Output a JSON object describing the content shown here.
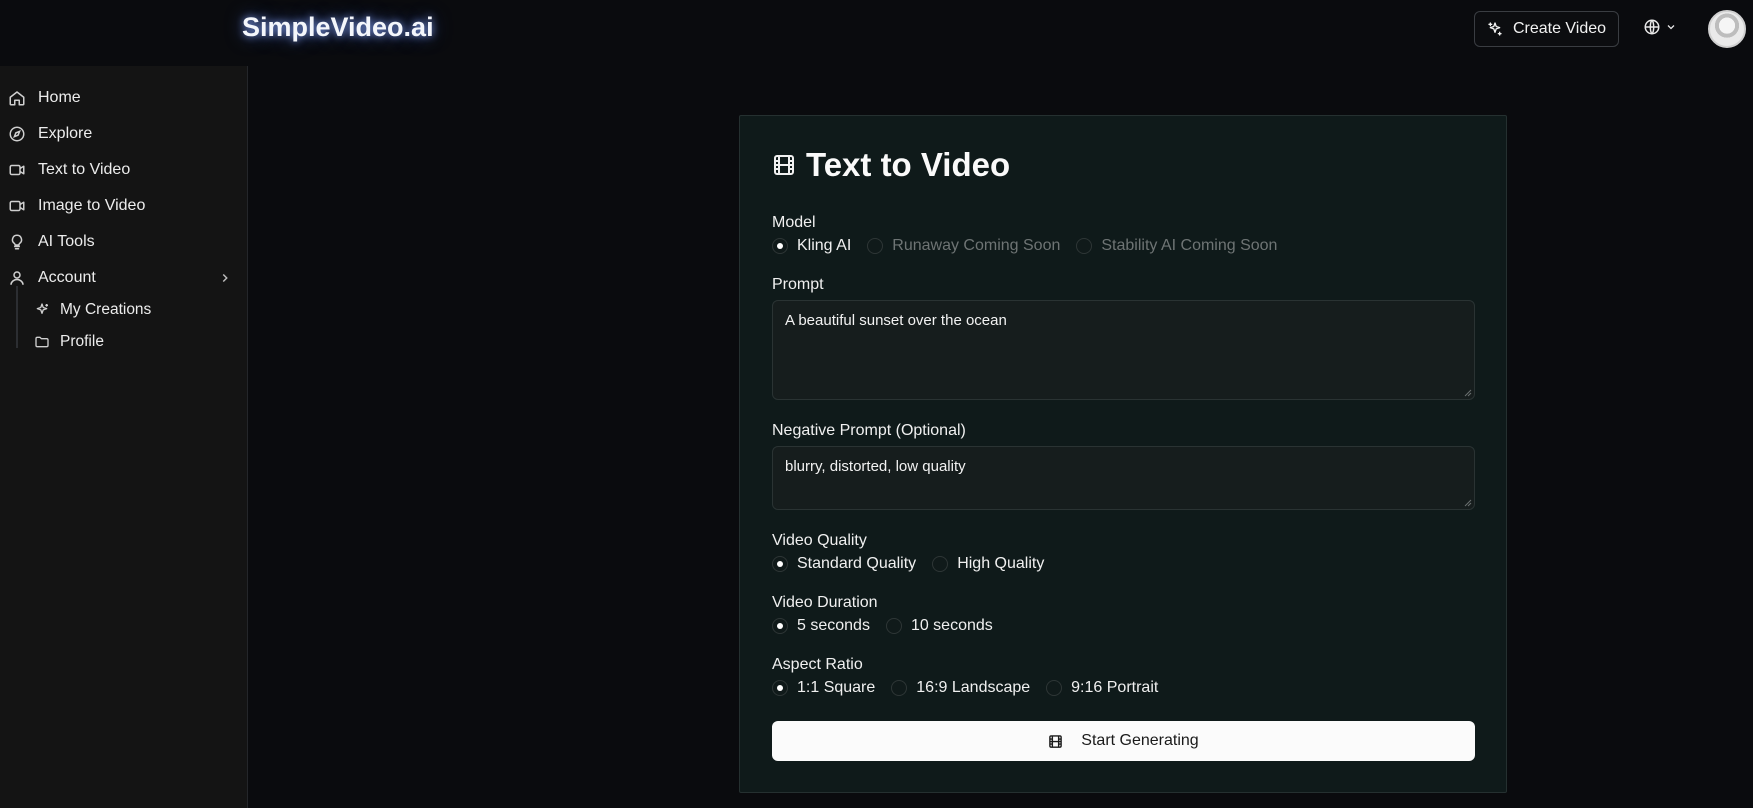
{
  "header": {
    "brand": "SimpleVideo.ai",
    "create_button": "Create Video"
  },
  "sidebar": {
    "items": [
      {
        "label": "Home",
        "icon": "home-icon"
      },
      {
        "label": "Explore",
        "icon": "compass-icon"
      },
      {
        "label": "Text to Video",
        "icon": "video-camera-icon"
      },
      {
        "label": "Image to Video",
        "icon": "video-camera-icon"
      },
      {
        "label": "AI Tools",
        "icon": "lightbulb-icon"
      },
      {
        "label": "Account",
        "icon": "user-icon"
      }
    ],
    "subitems": [
      {
        "label": "My Creations",
        "icon": "sparkles-icon"
      },
      {
        "label": "Profile",
        "icon": "folder-icon"
      }
    ]
  },
  "form": {
    "title": "Text to Video",
    "model": {
      "label": "Model",
      "options": [
        "Kling AI",
        "Runaway Coming Soon",
        "Stability AI Coming Soon"
      ],
      "selected": "Kling AI"
    },
    "prompt": {
      "label": "Prompt",
      "value": "A beautiful sunset over the ocean"
    },
    "negative_prompt": {
      "label": "Negative Prompt (Optional)",
      "value": "blurry, distorted, low quality"
    },
    "quality": {
      "label": "Video Quality",
      "options": [
        "Standard Quality",
        "High Quality"
      ],
      "selected": "Standard Quality"
    },
    "duration": {
      "label": "Video Duration",
      "options": [
        "5 seconds",
        "10 seconds"
      ],
      "selected": "5 seconds"
    },
    "aspect": {
      "label": "Aspect Ratio",
      "options": [
        "1:1 Square",
        "16:9 Landscape",
        "9:16 Portrait"
      ],
      "selected": "1:1 Square"
    },
    "submit": "Start Generating"
  },
  "colors": {
    "background": "#0a0b0e",
    "sidebar": "#141414",
    "card": "#0f1a1a",
    "button": "#fbfbfb"
  }
}
